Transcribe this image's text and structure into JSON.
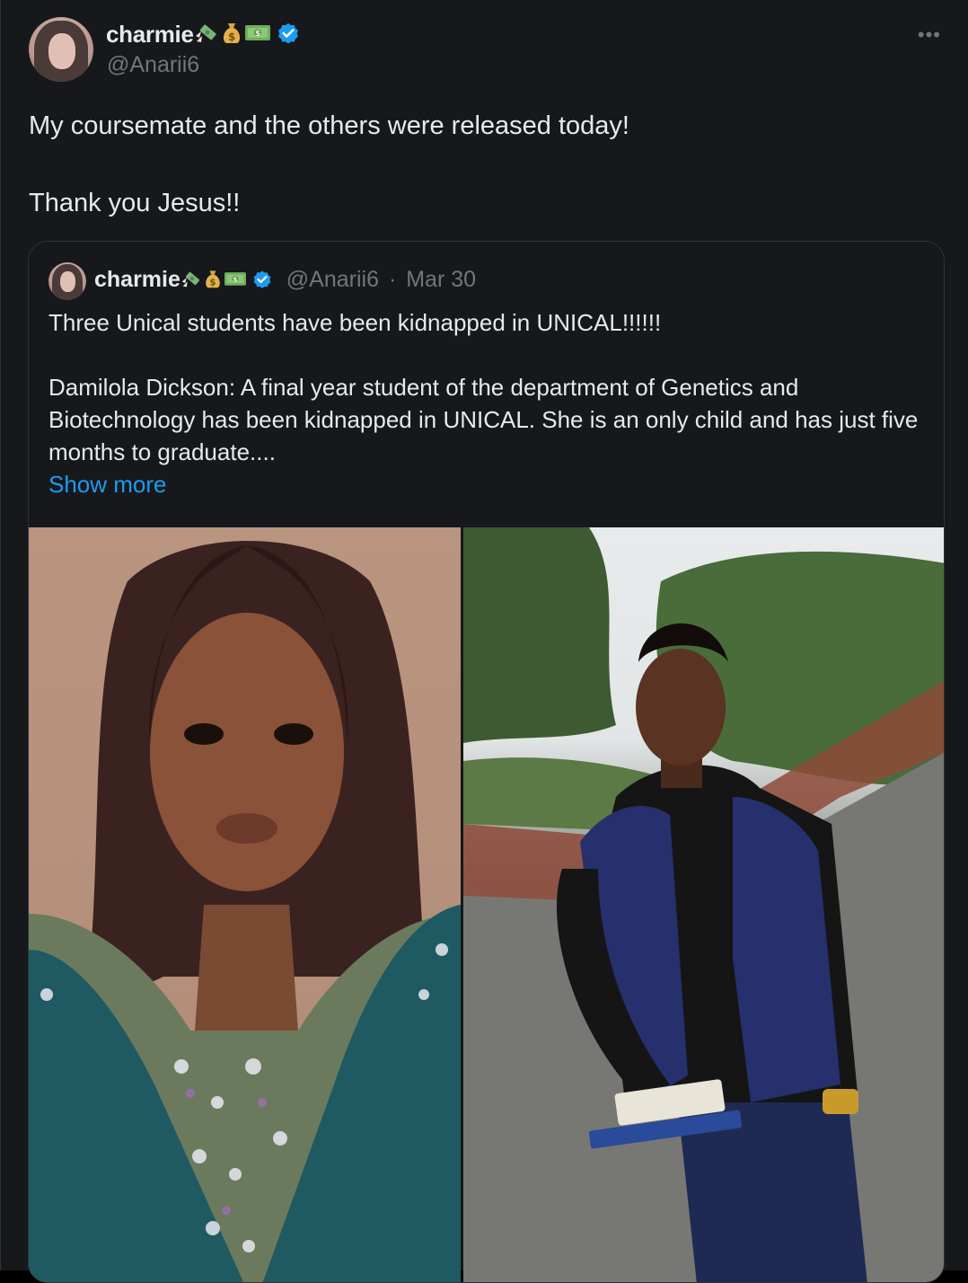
{
  "post": {
    "display_name": "charmie",
    "handle": "@Anarii6",
    "more_label": "•••",
    "text_lines": [
      "My coursemate and the others were released today!",
      "Thank you Jesus!!"
    ],
    "name_emojis": [
      "money-with-wings-icon",
      "money-bag-icon",
      "dollar-banknote-icon"
    ]
  },
  "quote": {
    "display_name": "charmie",
    "handle": "@Anarii6",
    "separator": "·",
    "date": "Mar 30",
    "headline": "Three Unical students have been kidnapped in UNICAL!!!!!!",
    "body": "Damilola Dickson: A final year student of the department of Genetics and Biotechnology  has been kidnapped in UNICAL. She is an only child and has just five months to graduate....",
    "show_more": "Show more",
    "images": [
      "portrait-woman-photo",
      "man-standing-outdoors-photo"
    ]
  },
  "colors": {
    "background": "#16181c",
    "text": "#e7e9ea",
    "muted": "#71767b",
    "link": "#1d9bf0",
    "verified": "#1d9bf0",
    "border": "#2f3336"
  }
}
